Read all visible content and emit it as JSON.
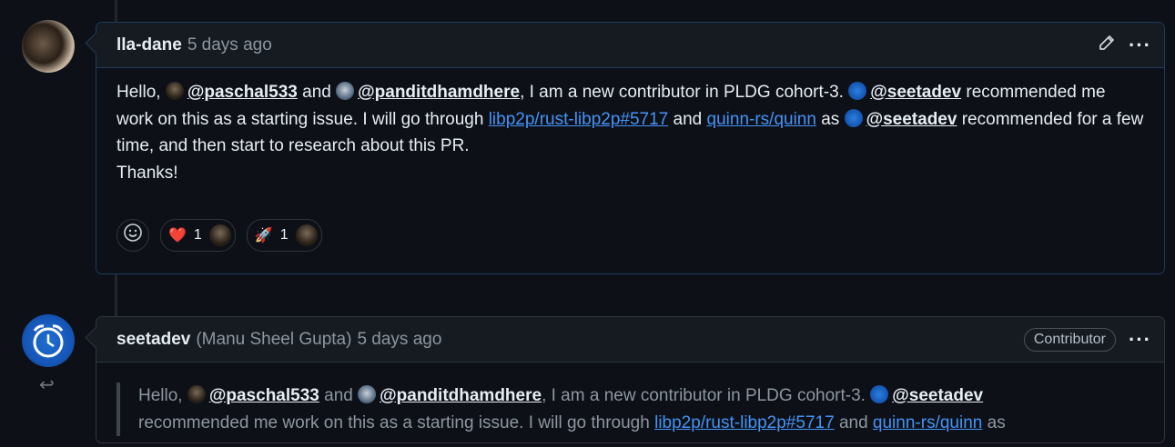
{
  "comment1": {
    "author": "lla-dane",
    "time": "5 days ago",
    "text": {
      "hello": "Hello,",
      "mention1": "@paschal533",
      "and1": "and",
      "mention2": "@panditdhamdhere",
      "p1": ", I am a new contributor in PLDG cohort-3.",
      "mention3": "@seetadev",
      "p2": "recommended me work on this as a starting issue. I will go through",
      "link1": "libp2p/rust-libp2p#5717",
      "and2": "and",
      "link2": "quinn-rs/quinn",
      "as": "as",
      "mention4": "@seetadev",
      "p3": "recommended for a few time, and then start to research about this PR.",
      "thanks": "Thanks!"
    },
    "reactions": [
      {
        "emoji": "❤️",
        "count": "1"
      },
      {
        "emoji": "🚀",
        "count": "1"
      }
    ]
  },
  "comment2": {
    "author": "seetadev",
    "fullname": "(Manu Sheel Gupta)",
    "time": "5 days ago",
    "badge": "Contributor",
    "quote": {
      "hello": "Hello,",
      "mention1": "@paschal533",
      "and1": "and",
      "mention2": "@panditdhamdhere",
      "p1": ", I am a new contributor in PLDG cohort-3.",
      "mention3": "@seetadev",
      "p2": "recommended me work on this as a starting issue. I will go through",
      "link1": "libp2p/rust-libp2p#5717",
      "and2": "and",
      "link2": "quinn-rs/quinn",
      "as": "as"
    }
  },
  "icons": {
    "edit": "pencil-icon",
    "more": "kebab-icon",
    "reaction": "smiley-icon",
    "reply": "reply-icon"
  },
  "colors": {
    "background": "#0d1117",
    "link": "#4493f8",
    "muted": "#8d96a0"
  }
}
